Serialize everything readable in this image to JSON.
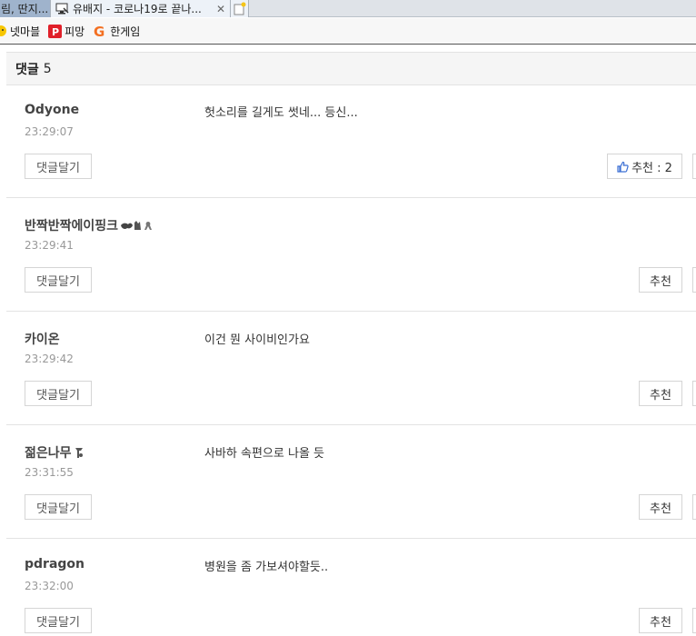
{
  "browser": {
    "tabs": [
      {
        "label": "림, 딴지..."
      },
      {
        "label": "유배지 - 코로나19로 끝나..."
      }
    ],
    "bookmarks": [
      {
        "label": "넷마블",
        "icon": "netmarble-icon"
      },
      {
        "label": "피망",
        "icon": "pmang-icon"
      },
      {
        "label": "한게임",
        "icon": "hangame-icon"
      }
    ]
  },
  "comments_section": {
    "title": "댓글",
    "count": "5",
    "reply_label": "댓글달기",
    "recommend_label": "추천"
  },
  "comments": [
    {
      "author": "Odyone",
      "time": "23:29:07",
      "text": "헛소리를 길게도 썻네... 등신...",
      "recommend": "추천 : 2"
    },
    {
      "author": "반짝반짝에이핑크",
      "time": "23:29:41",
      "text": "",
      "recommend": "추천"
    },
    {
      "author": "카이온",
      "time": "23:29:42",
      "text": "이건 뭔 사이비인가요",
      "recommend": "추천"
    },
    {
      "author": "젊은나무",
      "time": "23:31:55",
      "text": "사바하 속편으로 나올 듯",
      "recommend": "추천"
    },
    {
      "author": "pdragon",
      "time": "23:32:00",
      "text": "병원을 좀 가보셔야할듯..",
      "recommend": "추천"
    }
  ],
  "colors": {
    "header_bg": "#f5f5f5",
    "border": "#e3e3e3",
    "like_icon": "#3b6fd4",
    "pmang_red": "#e0202a",
    "hangame_orange": "#f36f21"
  }
}
